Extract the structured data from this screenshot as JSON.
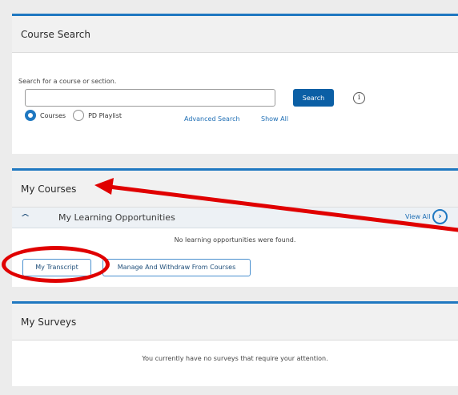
{
  "course_search": {
    "title": "Course Search",
    "hint": "Search for a course or section.",
    "search_value": "",
    "search_button": "Search",
    "info_icon": "i",
    "radio_options": [
      "Courses",
      "PD Playlist"
    ],
    "selected_option": "Courses",
    "advanced_search": "Advanced Search",
    "show_all": "Show All"
  },
  "my_courses": {
    "title": "My Courses",
    "section_title": "My Learning Opportunities",
    "view_all": "View All",
    "empty_message": "No learning opportunities were found.",
    "transcript_button": "My Transcript",
    "manage_button": "Manage And Withdraw From Courses"
  },
  "my_surveys": {
    "title": "My Surveys",
    "empty_message": "You currently have no surveys that require your attention."
  },
  "colors": {
    "accent": "#1f78c1",
    "primary_button": "#0b5fa5",
    "annotation": "#e00000"
  }
}
